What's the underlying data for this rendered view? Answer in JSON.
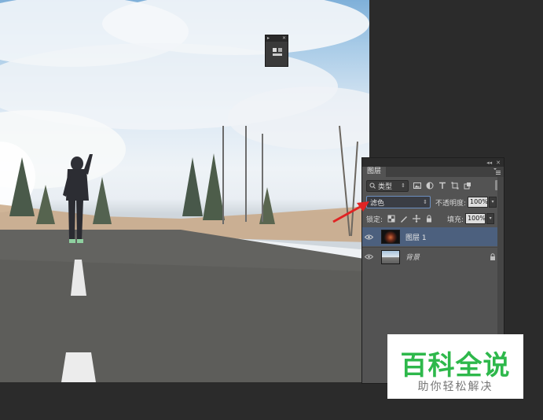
{
  "layers_panel": {
    "tab_label": "图层",
    "filter_select": "类型",
    "blend_mode": "滤色",
    "opacity_label": "不透明度:",
    "opacity_value": "100%",
    "lock_label": "锁定:",
    "fill_label": "填充:",
    "fill_value": "100%",
    "layers": [
      {
        "name": "图层 1",
        "selected": true
      },
      {
        "name": "背景",
        "locked": true
      }
    ]
  },
  "watermark": {
    "title": "百科全说",
    "subtitle": "助你轻松解决"
  },
  "colors": {
    "watermark_green": "#2eb84b",
    "arrow_red": "#e02424",
    "selected_layer": "#4c607e",
    "panel_bg": "#535353",
    "workspace_bg": "#2b2b2b"
  }
}
